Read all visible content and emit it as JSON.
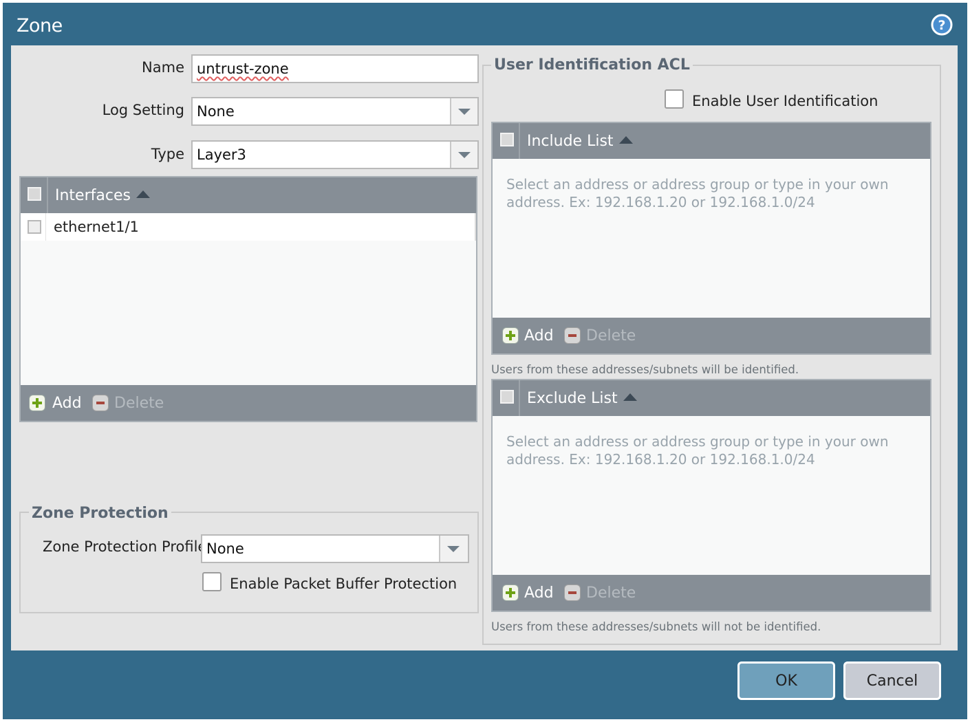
{
  "dialog": {
    "title": "Zone",
    "help_icon": "question-circle-icon"
  },
  "form": {
    "name_label": "Name",
    "name_value": "untrust-zone",
    "log_setting_label": "Log Setting",
    "log_setting_value": "None",
    "type_label": "Type",
    "type_value": "Layer3"
  },
  "interfaces": {
    "header": "Interfaces",
    "rows": [
      "ethernet1/1"
    ],
    "add_label": "Add",
    "delete_label": "Delete"
  },
  "zone_protection": {
    "legend": "Zone Protection",
    "profile_label": "Zone Protection Profile",
    "profile_value": "None",
    "packet_buffer_label": "Enable Packet Buffer Protection"
  },
  "user_id_acl": {
    "legend": "User Identification ACL",
    "enable_label": "Enable User Identification",
    "include": {
      "header": "Include List",
      "placeholder": "Select an address or address group or type in your own address. Ex: 192.168.1.20 or 192.168.1.0/24",
      "add_label": "Add",
      "delete_label": "Delete",
      "note": "Users from these addresses/subnets will be identified."
    },
    "exclude": {
      "header": "Exclude List",
      "placeholder": "Select an address or address group or type in your own address. Ex: 192.168.1.20 or 192.168.1.0/24",
      "add_label": "Add",
      "delete_label": "Delete",
      "note": "Users from these addresses/subnets will not be identified."
    }
  },
  "buttons": {
    "ok": "OK",
    "cancel": "Cancel"
  },
  "colors": {
    "title_bar": "#336a8a",
    "grid_header": "#868e96",
    "ok_button": "#6fa0bb",
    "cancel_button": "#c7cbd3"
  }
}
